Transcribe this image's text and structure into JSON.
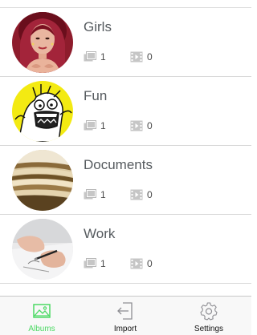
{
  "albums": [
    {
      "name": "Girls",
      "photos": "1",
      "videos": "0",
      "thumbnail": "woman-portrait"
    },
    {
      "name": "Fun",
      "photos": "1",
      "videos": "0",
      "thumbnail": "meme-face"
    },
    {
      "name": "Documents",
      "photos": "1",
      "videos": "0",
      "thumbnail": "paper-stack"
    },
    {
      "name": "Work",
      "photos": "1",
      "videos": "0",
      "thumbnail": "hands-writing"
    }
  ],
  "tabs": [
    {
      "label": "Albums",
      "icon": "image-icon",
      "active": true
    },
    {
      "label": "Import",
      "icon": "import-icon",
      "active": false
    },
    {
      "label": "Settings",
      "icon": "gear-icon",
      "active": false
    }
  ],
  "colors": {
    "accent": "#4cd964",
    "text": "#555a5e",
    "icon": "#b8b8b8"
  }
}
